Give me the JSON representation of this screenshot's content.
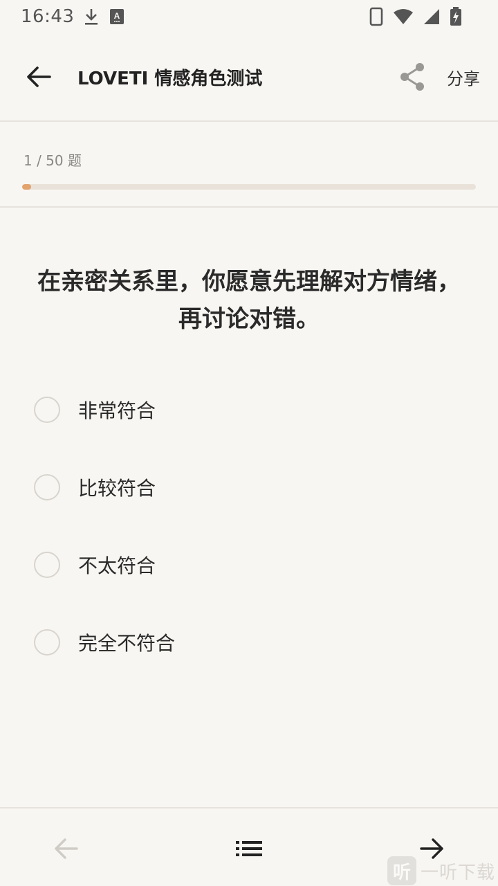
{
  "status_bar": {
    "time": "16:43",
    "left_icons": [
      "download-icon",
      "a-notification-icon"
    ],
    "right_icons": [
      "phone-icon",
      "wifi-icon",
      "signal-icon",
      "battery-charging-icon"
    ]
  },
  "app_bar": {
    "title": "LOVETI 情感角色测试",
    "share_label": "分享"
  },
  "progress": {
    "text": "1 / 50 题",
    "current": 1,
    "total": 50,
    "color": "#e3a36c"
  },
  "question": {
    "text": "在亲密关系里，你愿意先理解对方情绪，再讨论对错。"
  },
  "options": [
    {
      "label": "非常符合"
    },
    {
      "label": "比较符合"
    },
    {
      "label": "不太符合"
    },
    {
      "label": "完全不符合"
    }
  ],
  "bottom_nav": {
    "prev_icon": "arrow-left-icon",
    "list_icon": "list-icon",
    "next_icon": "arrow-right-icon"
  },
  "watermark": {
    "logo_char": "听",
    "text": "一听下载"
  }
}
